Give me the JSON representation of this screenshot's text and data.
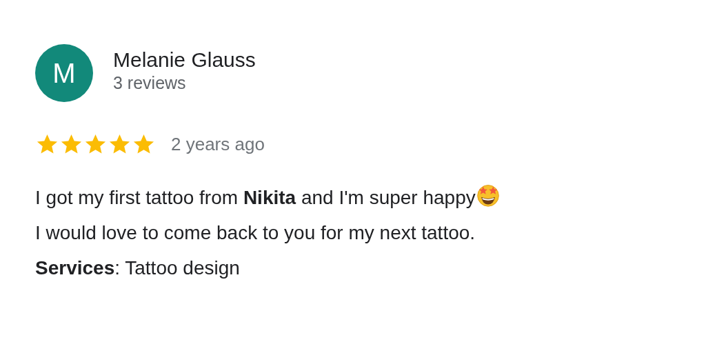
{
  "reviewer": {
    "initial": "M",
    "name": "Melanie Glauss",
    "review_count": "3 reviews"
  },
  "rating": {
    "stars": 5,
    "time": "2 years ago"
  },
  "body": [
    {
      "text": "I got my first tattoo from **Nikita** and I'm super happy",
      "emoji": true
    },
    {
      "text": "I would love to come back to you for my next tattoo.",
      "emoji": false
    },
    {
      "text": "**Services**: Tattoo design",
      "emoji": false
    }
  ]
}
